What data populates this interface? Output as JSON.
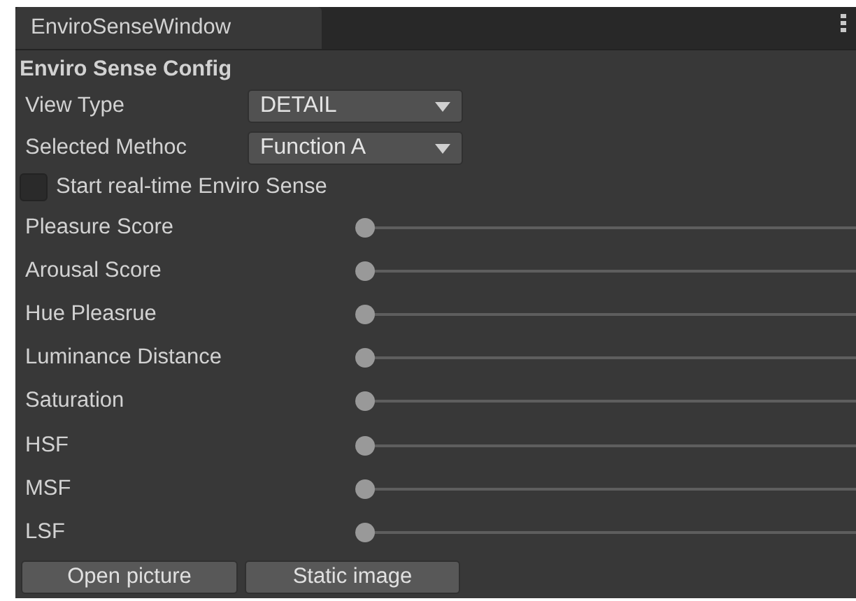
{
  "window": {
    "tab": "EnviroSenseWindow"
  },
  "header": "Enviro Sense Config",
  "fields": [
    {
      "label": "View Type",
      "value": "DETAIL"
    },
    {
      "label": "Selected Methoc",
      "value": "Function A"
    }
  ],
  "toggle": {
    "label": "Start real-time Enviro Sense",
    "checked": false
  },
  "sliders": [
    {
      "label": "Pleasure Score",
      "level": 0
    },
    {
      "label": "Arousal Score",
      "level": 0
    },
    {
      "label": "Hue Pleasrue",
      "level": 0
    },
    {
      "label": "Luminance Distance",
      "level": 0
    },
    {
      "label": "Saturation",
      "level": 0
    },
    {
      "label": "HSF",
      "level": 0
    },
    {
      "label": "MSF",
      "level": 0
    },
    {
      "label": "LSF",
      "level": 0
    }
  ],
  "buttons": [
    "Open picture",
    "Static image"
  ]
}
